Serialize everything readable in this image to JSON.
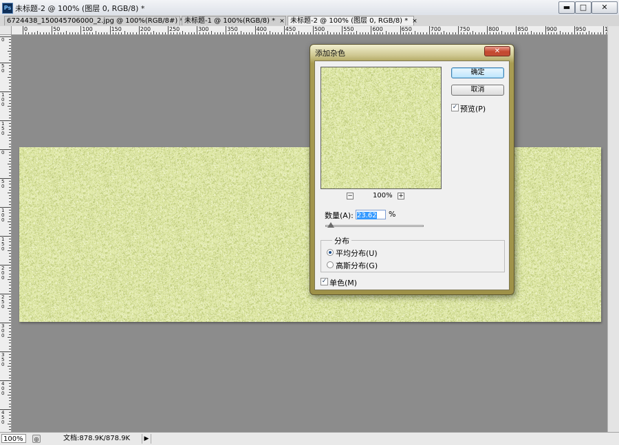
{
  "window": {
    "title": "未标题-2 @ 100% (图层 0, RGB/8) *",
    "app_icon_text": "Ps",
    "controls": {
      "minimize": "▬",
      "maximize": "□",
      "close": "✕"
    }
  },
  "tabs": [
    {
      "label": "6724438_150045706000_2.jpg @ 100%(RGB/8#) *",
      "close": "×",
      "active": false
    },
    {
      "label": "未标题-1 @ 100%(RGB/8) *",
      "close": "×",
      "active": false
    },
    {
      "label": "未标题-2 @ 100% (图层 0, RGB/8) *",
      "close": "×",
      "active": true
    }
  ],
  "ruler": {
    "top_labels": [
      "0",
      "50",
      "100",
      "150",
      "200",
      "250",
      "300",
      "350",
      "400",
      "450",
      "500",
      "550",
      "600",
      "650",
      "700",
      "750",
      "800",
      "850",
      "900",
      "950",
      "10"
    ],
    "left_labels": [
      "0",
      "50",
      "100",
      "150",
      "0",
      "50",
      "100",
      "150",
      "200",
      "250",
      "300",
      "350",
      "400",
      "450",
      "500"
    ]
  },
  "statusbar": {
    "zoom": "100%",
    "doc_info": "文档:878.9K/878.9K",
    "arrow": "▶"
  },
  "dialog": {
    "title": "添加杂色",
    "close": "✕",
    "ok_label": "确定",
    "cancel_label": "取消",
    "preview_label": "预览(P)",
    "preview_checked": true,
    "preview_zoom": "100%",
    "zoom_out": "−",
    "zoom_in": "+",
    "amount_label": "数量(A):",
    "amount_value": "23.62",
    "amount_unit": "%",
    "amount_slider_fraction": 0.0591,
    "distribution_title": "分布",
    "uniform_label": "平均分布(U)",
    "gaussian_label": "高斯分布(G)",
    "selected_distribution": "uniform",
    "monochromatic_label": "单色(M)",
    "monochromatic_checked": true,
    "check_mark": "✓"
  },
  "colors": {
    "noise_base": "#dfe8a6",
    "noise_dark": "#aebd6a",
    "noise_light": "#f4f8d8",
    "workspace": "#8c8c8c"
  }
}
